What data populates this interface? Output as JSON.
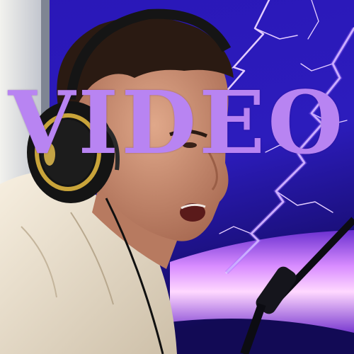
{
  "overlay": {
    "title": "VIDEO",
    "color": "#b884f2"
  },
  "palette": {
    "sky_deep": "#1a0d9a",
    "sky_mid": "#3a22c8",
    "lightning": "#d6b8ff",
    "floor_glow": "#c87cff",
    "shirt": "#efe4d0",
    "skin": "#d29a7e",
    "hair": "#2a1a12",
    "headphones": "#151515",
    "headphone_ring": "#c9a43a"
  }
}
